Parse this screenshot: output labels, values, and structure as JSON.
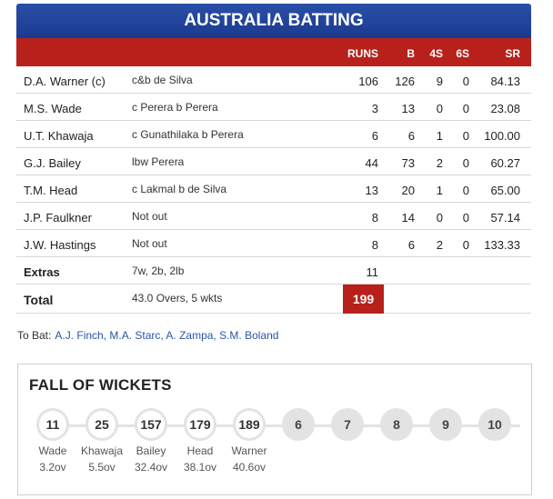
{
  "title": "AUSTRALIA BATTING",
  "columns": {
    "runs": "RUNS",
    "b": "B",
    "fours": "4S",
    "sixes": "6S",
    "sr": "SR"
  },
  "batting": [
    {
      "name": "D.A. Warner (c)",
      "dismissal": "c&b de Silva",
      "runs": "106",
      "b": "126",
      "fours": "9",
      "sixes": "0",
      "sr": "84.13"
    },
    {
      "name": "M.S. Wade",
      "dismissal": "c Perera b Perera",
      "runs": "3",
      "b": "13",
      "fours": "0",
      "sixes": "0",
      "sr": "23.08"
    },
    {
      "name": "U.T. Khawaja",
      "dismissal": "c Gunathilaka b Perera",
      "runs": "6",
      "b": "6",
      "fours": "1",
      "sixes": "0",
      "sr": "100.00"
    },
    {
      "name": "G.J. Bailey",
      "dismissal": "lbw Perera",
      "runs": "44",
      "b": "73",
      "fours": "2",
      "sixes": "0",
      "sr": "60.27"
    },
    {
      "name": "T.M. Head",
      "dismissal": "c Lakmal b de Silva",
      "runs": "13",
      "b": "20",
      "fours": "1",
      "sixes": "0",
      "sr": "65.00"
    },
    {
      "name": "J.P. Faulkner",
      "dismissal": "Not out",
      "runs": "8",
      "b": "14",
      "fours": "0",
      "sixes": "0",
      "sr": "57.14"
    },
    {
      "name": "J.W. Hastings",
      "dismissal": "Not out",
      "runs": "8",
      "b": "6",
      "fours": "2",
      "sixes": "0",
      "sr": "133.33"
    }
  ],
  "extras": {
    "label": "Extras",
    "detail": "7w, 2b, 2lb",
    "runs": "11"
  },
  "total": {
    "label": "Total",
    "detail": "43.0 Overs, 5 wkts",
    "runs": "199"
  },
  "to_bat": {
    "label": "To Bat:",
    "players": "A.J. Finch, M.A. Starc, A. Zampa, S.M. Boland"
  },
  "fall_of_wickets": {
    "title": "FALL OF WICKETS",
    "wickets": [
      {
        "score": "11",
        "batsman": "Wade",
        "over": "3.2ov"
      },
      {
        "score": "25",
        "batsman": "Khawaja",
        "over": "5.5ov"
      },
      {
        "score": "157",
        "batsman": "Bailey",
        "over": "32.4ov"
      },
      {
        "score": "179",
        "batsman": "Head",
        "over": "38.1ov"
      },
      {
        "score": "189",
        "batsman": "Warner",
        "over": "40.6ov"
      },
      {
        "score": "6"
      },
      {
        "score": "7"
      },
      {
        "score": "8"
      },
      {
        "score": "9"
      },
      {
        "score": "10"
      }
    ]
  },
  "colors": {
    "header_blue": "#1a3a8f",
    "header_red": "#b8211b",
    "link_blue": "#2a56a6"
  }
}
